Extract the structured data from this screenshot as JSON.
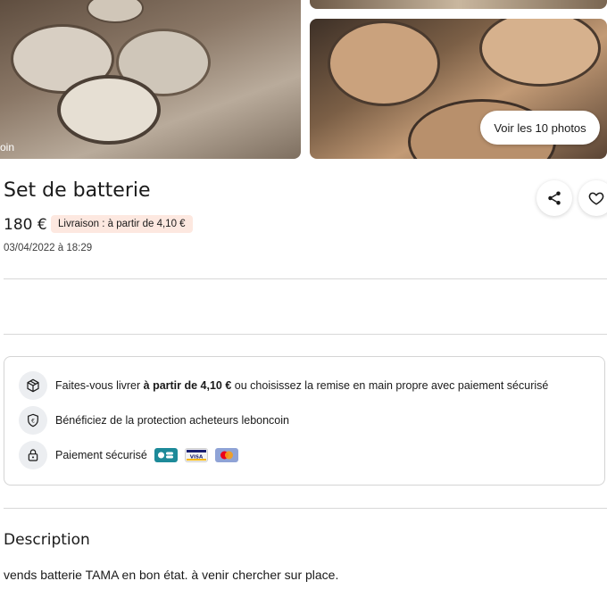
{
  "gallery": {
    "watermark": "oin",
    "photos_button": "Voir les 10 photos"
  },
  "ad": {
    "title": "Set de batterie",
    "price": "180 €",
    "delivery_badge": "Livraison : à partir de 4,10 €",
    "date": "03/04/2022 à 18:29"
  },
  "actions": {
    "share_icon": "share-icon",
    "favorite_icon": "heart-icon"
  },
  "info": {
    "delivery": {
      "icon": "package-icon",
      "text_before": "Faites-vous livrer ",
      "text_bold": "à partir de 4,10 €",
      "text_after": " ou choisissez la remise en main propre avec paiement sécurisé"
    },
    "protection": {
      "icon": "shield-euro-icon",
      "text": "Bénéficiez de la protection acheteurs leboncoin"
    },
    "payment": {
      "icon": "lock-icon",
      "text": "Paiement sécurisé",
      "cards": [
        {
          "name": "cb-card-icon",
          "label": "CB",
          "color": "#1d8a99"
        },
        {
          "name": "visa-card-icon",
          "label": "VISA",
          "color": "#1a1f71"
        },
        {
          "name": "mastercard-card-icon",
          "label": "",
          "color": "#ff5f00"
        }
      ]
    }
  },
  "description": {
    "title": "Description",
    "text": "vends batterie TAMA en bon état. à venir chercher sur place."
  },
  "colors": {
    "badge_bg": "#fde8e0",
    "divider": "#d8d8d8",
    "icon_bg": "#eceef1"
  }
}
